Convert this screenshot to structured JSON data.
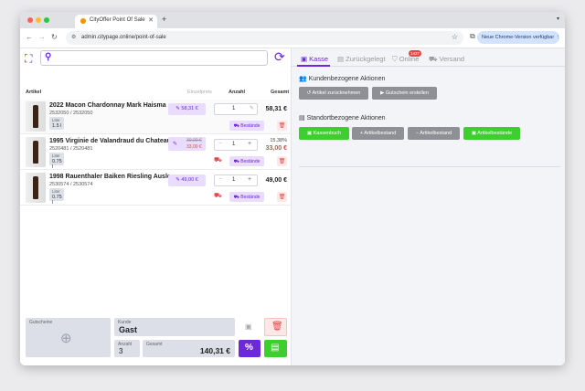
{
  "browser": {
    "tab_title": "CityOffer Point Of Sale",
    "url": "admin.citypage.online/point-of-sale",
    "update_label": "Neue Chrome-Version verfügbar",
    "colors": {
      "tab_strip": "#dfe1e5",
      "update_pill": "#d3e3fd"
    }
  },
  "pos": {
    "search": {
      "placeholder": "",
      "value": ""
    },
    "columns": {
      "article": "Artikel",
      "unit_price": "Einzelpreis",
      "quantity": "Anzahl",
      "total": "Gesamt"
    },
    "items": [
      {
        "name": "2022 Macon Chardonnay Mark Haisma",
        "sku": "2532050 / 2532050",
        "liter_label": "Liter",
        "liter": "1.5 l",
        "price": "58,31 €",
        "qty": "1",
        "total": "58,31 €",
        "stock_label": "Bestände"
      },
      {
        "name": "1995 Virginie de Valandraud du Chateau V...",
        "sku": "2520481 / 2520481",
        "liter_label": "Liter",
        "liter": "0.75 l",
        "old_price": "39,00 €",
        "price": "33,00 €",
        "discount": "15.38%",
        "qty": "1",
        "total": "33,00 €",
        "stock_label": "Bestände"
      },
      {
        "name": "1998 Rauenthaler Baiken Riesling Auslese ...",
        "sku": "2530574 / 2530574",
        "liter_label": "Liter",
        "liter": "0.75 l",
        "price": "49,00 €",
        "qty": "1",
        "total": "49,00 €",
        "stock_label": "Bestände"
      }
    ],
    "footer": {
      "vouchers_label": "Gutscheine",
      "customer_label": "Kunde",
      "customer_value": "Gast",
      "count_label": "Anzahl",
      "count_value": "3",
      "total_label": "Gesamt",
      "total_value": "140,31 €"
    },
    "colors": {
      "accent": "#6d28d9",
      "accent_light": "#e9dcfd",
      "danger": "#e04848",
      "success": "#3ccf2e"
    }
  },
  "panel": {
    "tabs": [
      {
        "label": "Kasse",
        "active": true
      },
      {
        "label": "Zurückgelegt"
      },
      {
        "label": "Online",
        "badge": "1437"
      },
      {
        "label": "Versand"
      }
    ],
    "customer_section": {
      "title": "Kundenbezogene Aktionen",
      "buttons": [
        "Artikel zurücknehmen",
        "Gutschein erstellen"
      ]
    },
    "location_section": {
      "title": "Standortbezogene Aktionen",
      "buttons": [
        "Kassenbuch",
        "Artikelbestand",
        "Artikelbestand",
        "Artikelbestände"
      ]
    }
  }
}
